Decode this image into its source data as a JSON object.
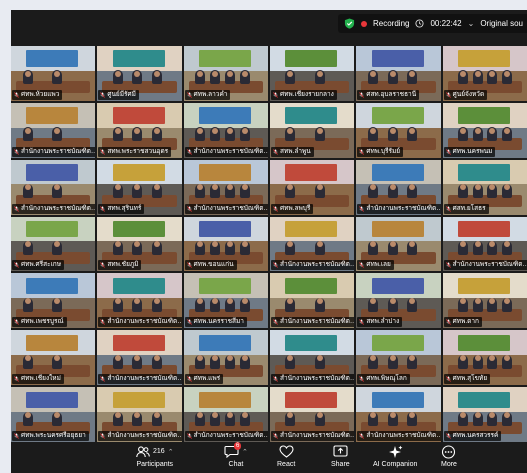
{
  "header": {
    "recording_label": "Recording",
    "timer": "00:22:42",
    "view_label": "Original sou"
  },
  "tiles": [
    {
      "label": "ศทพ.ห้วยแพว"
    },
    {
      "label": "ศูนย์มีรัศมี"
    },
    {
      "label": "ศทพ.ลาวคำ"
    },
    {
      "label": "ศทพ.เชียงรายกลาง"
    },
    {
      "label": "ศสท.อุบลราชธานี"
    },
    {
      "label": "ศูนย์จังหวัด"
    },
    {
      "label": "สำนักงานพระราชบัณฑิตยสภาจังหวัด"
    },
    {
      "label": "สทพ.พระราชสวนอุดร"
    },
    {
      "label": "สำนักงานพระราชบัณฑิตจังหวัด"
    },
    {
      "label": "สทพ.ลำพูน"
    },
    {
      "label": "ศทพ.บุรีรัมย์"
    },
    {
      "label": "ศทพ.นครพนม"
    },
    {
      "label": "สำนักงานพระราชบัณฑิตจังหวัด"
    },
    {
      "label": "สทพ.สุรินทร์"
    },
    {
      "label": "สำนักงานพระราชบัณฑิตจังหวัด"
    },
    {
      "label": "ศทพ.ลพบุรี"
    },
    {
      "label": "สำนักงานพระราชบัณฑิตจังหวัด"
    },
    {
      "label": "ศสท.ยโสธร"
    },
    {
      "label": "ศทพ.ศรีสะเกษ"
    },
    {
      "label": "สทพ.ชัยภูมิ"
    },
    {
      "label": "ศทพ.ขอนแก่น"
    },
    {
      "label": "สำนักงานพระราชบัณฑิตจังหวัด"
    },
    {
      "label": "ศทพ.เลย"
    },
    {
      "label": "สำนักงานพระราชบัณฑิตจังหวัด"
    },
    {
      "label": "ศทพ.เพชรบูรณ์"
    },
    {
      "label": "สำนักงานพระราชบัณฑิตจังหวัด"
    },
    {
      "label": "ศทพ.นครราชสีมา"
    },
    {
      "label": "สำนักงานพระราชบัณฑิตจังหวัด"
    },
    {
      "label": "สทพ.ลำปาง"
    },
    {
      "label": "ศทพ.ตาก"
    },
    {
      "label": "ศทพ.เชียงใหม่"
    },
    {
      "label": "สำนักงานพระราชบัณฑิตจังหวัด"
    },
    {
      "label": "ศทพ.แพร่"
    },
    {
      "label": "สำนักงานพระราชบัณฑิตจังหวัด"
    },
    {
      "label": "ศทพ.พิษณุโลก"
    },
    {
      "label": "ศทพ.สุโขทัย"
    },
    {
      "label": "ศทพ.พระนครศรีอยุธยา"
    },
    {
      "label": "สำนักงานพระราชบัณฑิตจังหวัด"
    },
    {
      "label": "สำนักงานพระราชบัณฑิตจังหวัด"
    },
    {
      "label": "สำนักงานพระราชบัณฑิตจังหวัด"
    },
    {
      "label": "สำนักงานพระราชบัณฑิตจังหวัด"
    },
    {
      "label": "ศทพ.นครสวรรค์"
    }
  ],
  "toolbar": {
    "participants_label": "Participants",
    "participants_count": "216",
    "chat_label": "Chat",
    "chat_badge": "6",
    "react_label": "React",
    "share_label": "Share",
    "ai_label": "AI Companion",
    "more_label": "More"
  }
}
